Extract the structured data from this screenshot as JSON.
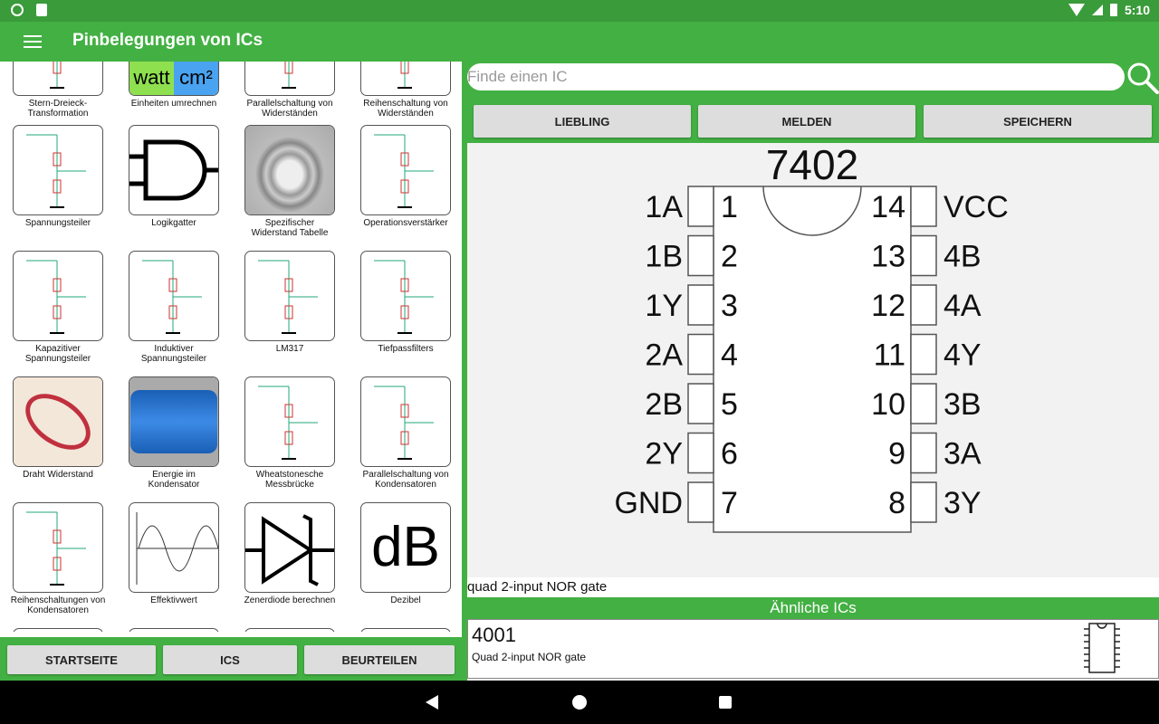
{
  "status": {
    "time": "5:10"
  },
  "appbar": {
    "title": "Pinbelegungen von ICs"
  },
  "left": {
    "tiles": [
      {
        "label": "Stern-Dreieck-\nTransformation",
        "icon": "star-delta-icon"
      },
      {
        "label": "Einheiten umrechnen",
        "icon": "units-icon",
        "t1": "watt",
        "t2": "cm²"
      },
      {
        "label": "Parallelschaltung von\nWiderständen",
        "icon": "parallel-resistors-icon"
      },
      {
        "label": "Reihenschaltung von\nWiderständen",
        "icon": "series-resistors-icon"
      },
      {
        "label": "Spannungsteiler",
        "icon": "voltage-divider-icon"
      },
      {
        "label": "Logikgatter",
        "icon": "logic-gate-icon"
      },
      {
        "label": "Spezifischer\nWiderstand Tabelle",
        "icon": "wire-coil-icon"
      },
      {
        "label": "Operationsverstärker",
        "icon": "opamp-icon"
      },
      {
        "label": "Kapazitiver\nSpannungsteiler",
        "icon": "capacitive-divider-icon"
      },
      {
        "label": "Induktiver\nSpannungsteiler",
        "icon": "inductive-divider-icon"
      },
      {
        "label": "LM317",
        "icon": "lm317-icon"
      },
      {
        "label": "Tiefpassfilters",
        "icon": "lowpass-icon"
      },
      {
        "label": "Draht Widerstand",
        "icon": "wire-icon"
      },
      {
        "label": "Energie im\nKondensator",
        "icon": "capacitor-photo-icon"
      },
      {
        "label": "Wheatstonesche\nMessbrücke",
        "icon": "wheatstone-icon"
      },
      {
        "label": "Parallelschaltung von\nKondensatoren",
        "icon": "parallel-caps-icon"
      },
      {
        "label": "Reihenschaltungen von\nKondensatoren",
        "icon": "series-caps-icon"
      },
      {
        "label": "Effektivwert",
        "icon": "rms-icon"
      },
      {
        "label": "Zenerdiode berechnen",
        "icon": "zener-icon"
      },
      {
        "label": "Dezibel",
        "icon": "decibel-icon",
        "t1": "dB"
      }
    ],
    "nav": {
      "home": "STARTSEITE",
      "ics": "ICS",
      "rate": "BEURTEILEN"
    }
  },
  "right": {
    "search_placeholder": "Finde einen IC",
    "buttons": {
      "favorite": "LIEBLING",
      "report": "MELDEN",
      "save": "SPEICHERN"
    },
    "ic": {
      "name": "7402",
      "left_pins": [
        [
          "1A",
          "1"
        ],
        [
          "1B",
          "2"
        ],
        [
          "1Y",
          "3"
        ],
        [
          "2A",
          "4"
        ],
        [
          "2B",
          "5"
        ],
        [
          "2Y",
          "6"
        ],
        [
          "GND",
          "7"
        ]
      ],
      "right_pins": [
        [
          "14",
          "VCC"
        ],
        [
          "13",
          "4B"
        ],
        [
          "12",
          "4A"
        ],
        [
          "11",
          "4Y"
        ],
        [
          "10",
          "3B"
        ],
        [
          "9",
          "3A"
        ],
        [
          "8",
          "3Y"
        ]
      ]
    },
    "description": "quad 2-input NOR gate",
    "similar_header": "Ähnliche ICs",
    "similar": [
      {
        "name": "4001",
        "desc": "Quad 2-input NOR gate"
      }
    ]
  }
}
